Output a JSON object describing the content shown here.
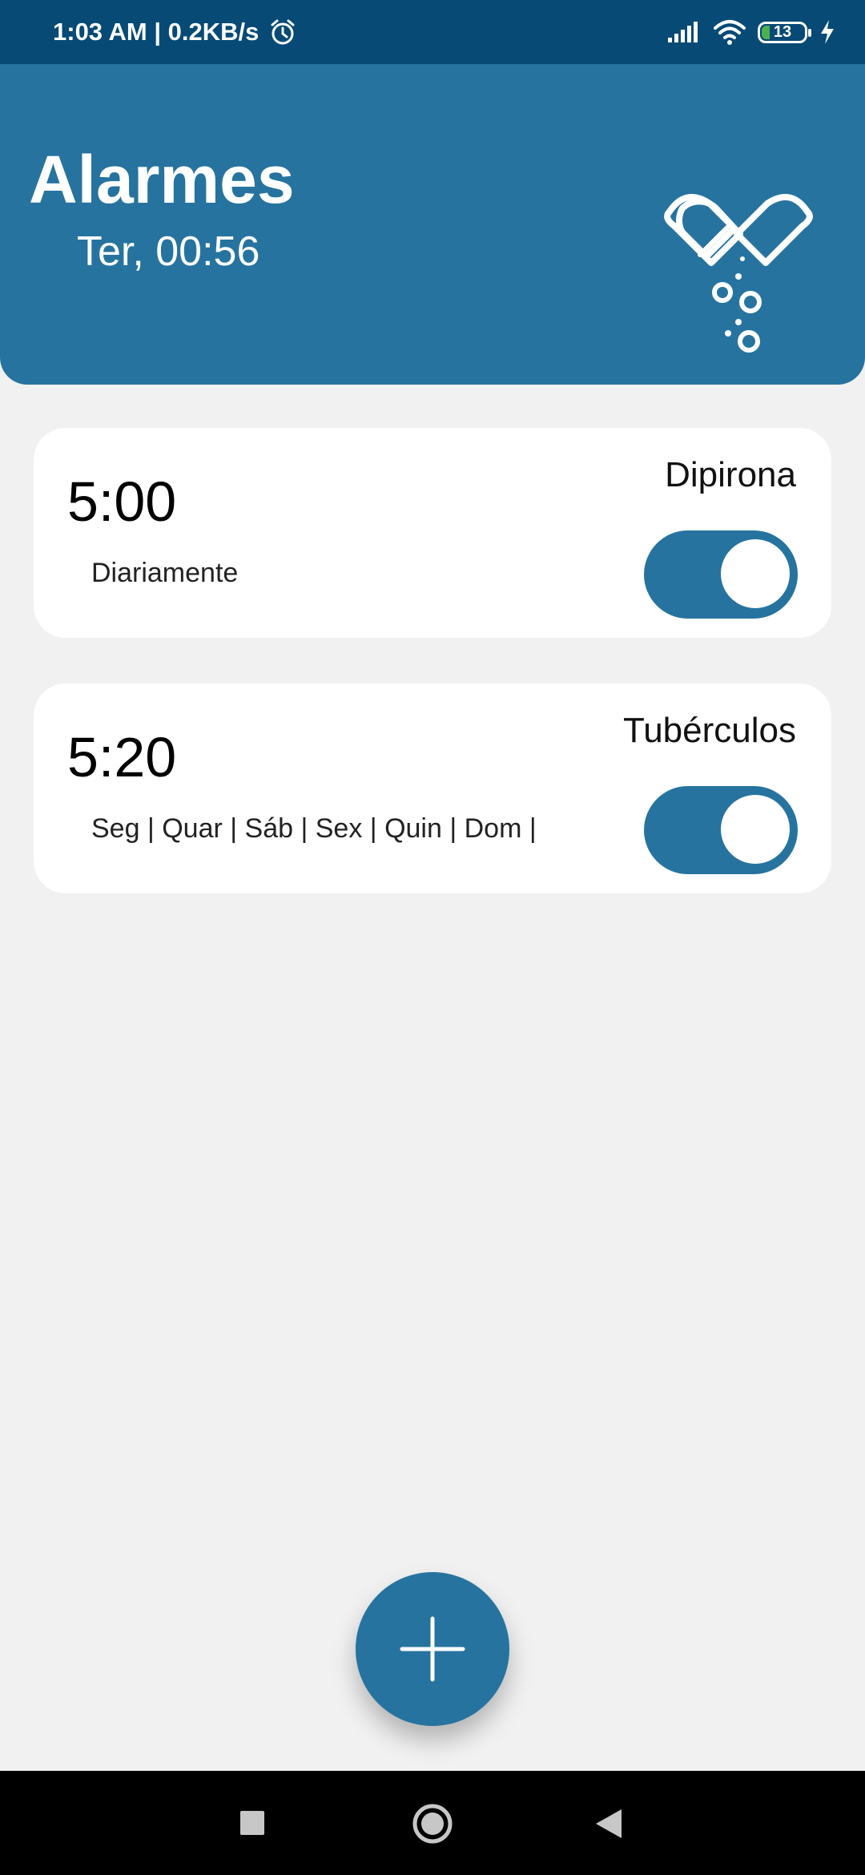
{
  "status": {
    "time_speed": "1:03 AM | 0.2KB/s",
    "battery": "13"
  },
  "header": {
    "title": "Alarmes",
    "subtitle": "Ter, 00:56"
  },
  "alarms": [
    {
      "time": "5:00",
      "name": "Dipirona",
      "days": "Diariamente",
      "enabled": true
    },
    {
      "time": "5:20",
      "name": "Tubérculos",
      "days": "Seg | Quar | Sáb | Sex | Quin | Dom |",
      "enabled": true
    }
  ],
  "icons": {
    "alarm": "alarm-clock-icon",
    "signal": "signal-icon",
    "wifi": "wifi-icon",
    "battery": "battery-icon",
    "charging": "lightning-icon",
    "logo": "pill-heart-icon",
    "add": "plus-icon",
    "recents": "square-icon",
    "home": "circle-icon",
    "back": "triangle-back-icon"
  },
  "colors": {
    "primary": "#26739f",
    "status_bar": "#064a75",
    "background": "#f1f1f1"
  }
}
